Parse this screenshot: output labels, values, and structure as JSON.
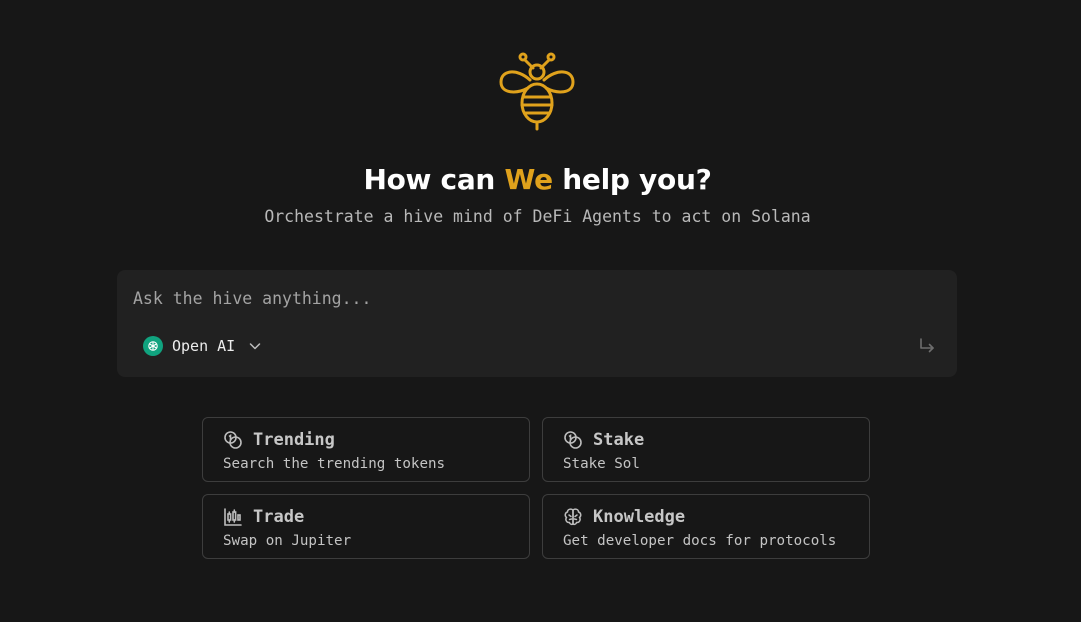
{
  "hero": {
    "logo_icon": "bee-icon",
    "headline_before": "How can ",
    "headline_accent": "We",
    "headline_after": " help you?",
    "subtitle": "Orchestrate a hive mind of DeFi Agents to act on Solana"
  },
  "prompt": {
    "placeholder": "Ask the hive anything...",
    "value": "",
    "model": {
      "label": "Open AI",
      "icon": "openai-icon"
    },
    "submit_icon": "corner-down-right-icon"
  },
  "suggestions": [
    {
      "title": "Trending",
      "description": "Search the trending tokens",
      "icon": "coins-icon"
    },
    {
      "title": "Stake",
      "description": "Stake Sol",
      "icon": "coins-icon"
    },
    {
      "title": "Trade",
      "description": "Swap on Jupiter",
      "icon": "candlestick-chart-icon"
    },
    {
      "title": "Knowledge",
      "description": "Get developer docs for protocols",
      "icon": "brain-icon"
    }
  ],
  "colors": {
    "background": "#171717",
    "accent": "#e0a21c",
    "input_bg": "#212121",
    "card_border": "#3d3d3d"
  }
}
